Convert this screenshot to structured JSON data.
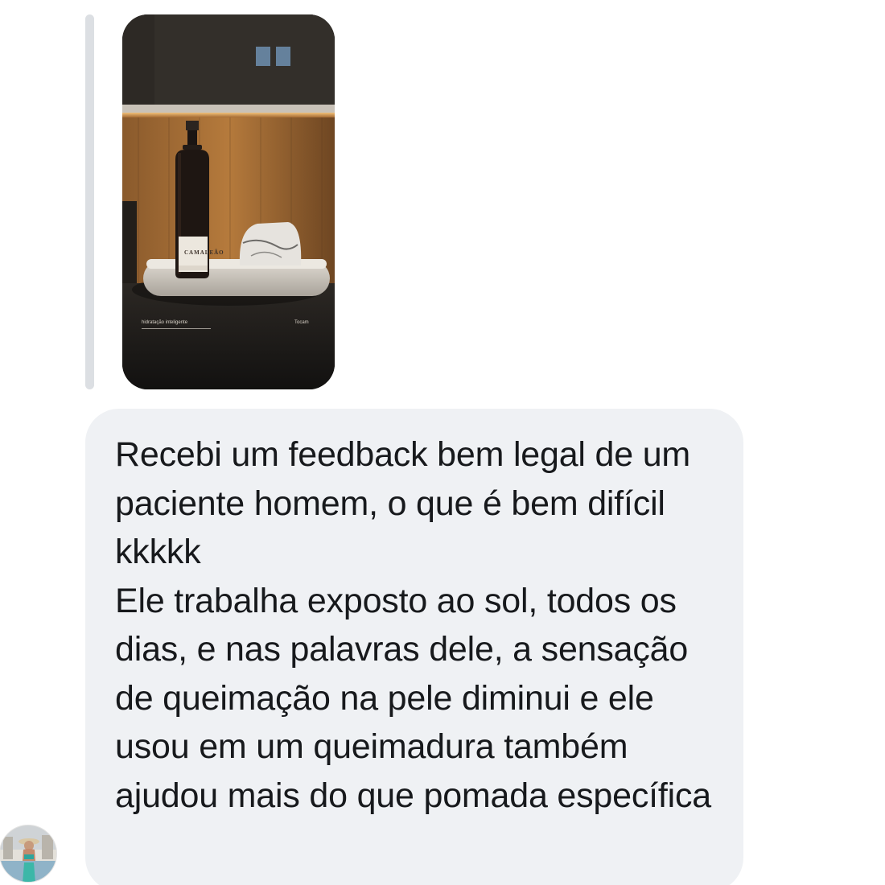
{
  "thread": {
    "story_reply": {
      "image": {
        "caption_left": "hidratação inteligente",
        "caption_right": "Tocam",
        "bottle_label": "CAMALEÃO",
        "colors": {
          "background": "#1d1a17",
          "wood_glow": "#b57a3c",
          "bottle": "#1e1612",
          "tray": "#d8d2ca"
        }
      }
    },
    "message": {
      "paragraphs": [
        "Recebi um feedback bem legal de um paciente homem, o que é bem difícil kkkkk",
        "Ele trabalha exposto ao sol, todos os dias, e nas palavras dele, a sensação de queimação na pele diminui e ele usou em um queimadura também ajudou mais do que pomada específica"
      ],
      "colors": {
        "bubble": "#eff1f4",
        "text": "#17191c"
      }
    },
    "sender": {
      "avatar_icon": "profile-photo-avatar"
    }
  }
}
